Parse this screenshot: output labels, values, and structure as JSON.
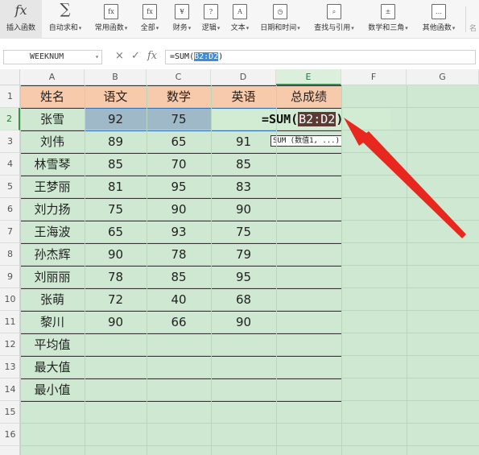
{
  "ribbon": {
    "buttons": [
      {
        "id": "insert",
        "label": "插入函数",
        "icon": "fx-icon",
        "glyph": "fx",
        "caret": false
      },
      {
        "id": "autosum",
        "label": "自动求和",
        "icon": "sigma-icon",
        "glyph": "∑",
        "caret": true
      },
      {
        "id": "common",
        "label": "常用函数",
        "icon": "common-functions-icon",
        "glyph": "fx",
        "caret": true
      },
      {
        "id": "all",
        "label": "全部",
        "icon": "all-functions-icon",
        "glyph": "fx",
        "caret": true
      },
      {
        "id": "finance",
        "label": "财务",
        "icon": "finance-icon",
        "glyph": "¥",
        "caret": true
      },
      {
        "id": "logic",
        "label": "逻辑",
        "icon": "logic-icon",
        "glyph": "?",
        "caret": true
      },
      {
        "id": "text",
        "label": "文本",
        "icon": "text-icon",
        "glyph": "A",
        "caret": true
      },
      {
        "id": "datetime",
        "label": "日期和时间",
        "icon": "clock-icon",
        "glyph": "◷",
        "caret": true
      },
      {
        "id": "lookup",
        "label": "查找与引用",
        "icon": "lookup-icon",
        "glyph": "⌕",
        "caret": true
      },
      {
        "id": "math",
        "label": "数学和三角",
        "icon": "math-icon",
        "glyph": "±",
        "caret": true
      },
      {
        "id": "other",
        "label": "其他函数",
        "icon": "other-functions-icon",
        "glyph": "…",
        "caret": true
      }
    ],
    "more_label": "名"
  },
  "formula_bar": {
    "name_box": "WEEKNUM",
    "cancel_icon": "×",
    "confirm_icon": "✓",
    "fx_icon": "fx",
    "formula_prefix": "=SUM(",
    "formula_ref": "B2:D2",
    "formula_suffix": ")"
  },
  "columns": [
    "A",
    "B",
    "C",
    "D",
    "E",
    "F",
    "G"
  ],
  "rows": [
    "1",
    "2",
    "3",
    "4",
    "5",
    "6",
    "7",
    "8",
    "9",
    "10",
    "11",
    "12",
    "13",
    "14",
    "15",
    "16"
  ],
  "sheet": {
    "headers": [
      "姓名",
      "语文",
      "数学",
      "英语",
      "总成绩"
    ],
    "records": [
      [
        "张雪",
        "92",
        "75",
        ""
      ],
      [
        "刘伟",
        "89",
        "65",
        "91"
      ],
      [
        "林雪琴",
        "85",
        "70",
        "85"
      ],
      [
        "王梦丽",
        "81",
        "95",
        "83"
      ],
      [
        "刘力扬",
        "75",
        "90",
        "90"
      ],
      [
        "王海波",
        "65",
        "93",
        "75"
      ],
      [
        "孙杰辉",
        "90",
        "78",
        "79"
      ],
      [
        "刘丽丽",
        "78",
        "85",
        "95"
      ],
      [
        "张萌",
        "72",
        "40",
        "68"
      ],
      [
        "黎川",
        "90",
        "66",
        "90"
      ]
    ],
    "summary_rows": [
      "平均值",
      "最大值",
      "最小值"
    ]
  },
  "editing": {
    "prefix": "=SUM(",
    "ref": "B2:D2",
    "suffix": ")",
    "tooltip": "SUM (数值1, ...)"
  },
  "colors": {
    "header_fill": "#f7caac",
    "selected_range_fill": "#9fb9c8",
    "sheet_background": "#cfe8d1",
    "annotation_arrow": "#e8271f"
  }
}
